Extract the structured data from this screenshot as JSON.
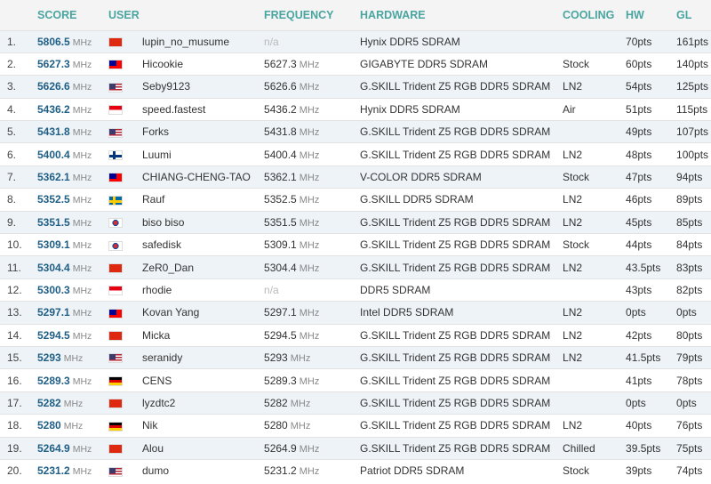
{
  "columns": {
    "score": "SCORE",
    "user": "USER",
    "frequency": "FREQUENCY",
    "hardware": "HARDWARE",
    "cooling": "COOLING",
    "hw": "HW",
    "gl": "GL"
  },
  "flag_styles": {
    "hk": "background:#de2910;",
    "tw": "background:linear-gradient(#000095,#000095) 0 0/8px 6px no-repeat,#fe0000;",
    "us": "background:linear-gradient(#3c3b6e,#3c3b6e) 0 0/7px 6px no-repeat,repeating-linear-gradient(#b22234 0 1.5px,#fff 1.5px 3px);",
    "id": "background:linear-gradient(#e70011 50%,#fff 50%);",
    "fi": "background:linear-gradient(90deg,transparent 4px,#003580 4px 7px,transparent 7px),linear-gradient(transparent 4px,#003580 4px 7px,transparent 7px),#fff;",
    "se": "background:linear-gradient(90deg,transparent 4px,#fecc00 4px 7px,transparent 7px),linear-gradient(transparent 4px,#fecc00 4px 7px,transparent 7px),#006aa7;",
    "kr": "background:radial-gradient(circle,#cd2e3a 0 2.5px,#0047a0 2.5px 3.5px,transparent 3.5px),#fff;",
    "cn": "background:#de2910;",
    "de": "background:linear-gradient(#000 33%,#dd0000 33% 66%,#ffce00 66%);"
  },
  "rows": [
    {
      "rank": "1.",
      "score": "5806.5",
      "score_unit": "MHz",
      "flag": "hk",
      "user": "lupin_no_musume",
      "freq": "n/a",
      "freq_unit": "",
      "hardware": "Hynix DDR5 SDRAM",
      "cooling": "",
      "hw": "70pts",
      "gl": "161pts"
    },
    {
      "rank": "2.",
      "score": "5627.3",
      "score_unit": "MHz",
      "flag": "tw",
      "user": "Hicookie",
      "freq": "5627.3",
      "freq_unit": "MHz",
      "hardware": "GIGABYTE DDR5 SDRAM",
      "cooling": "Stock",
      "hw": "60pts",
      "gl": "140pts"
    },
    {
      "rank": "3.",
      "score": "5626.6",
      "score_unit": "MHz",
      "flag": "us",
      "user": "Seby9123",
      "freq": "5626.6",
      "freq_unit": "MHz",
      "hardware": "G.SKILL Trident Z5 RGB DDR5 SDRAM",
      "cooling": "LN2",
      "hw": "54pts",
      "gl": "125pts"
    },
    {
      "rank": "4.",
      "score": "5436.2",
      "score_unit": "MHz",
      "flag": "id",
      "user": "speed.fastest",
      "freq": "5436.2",
      "freq_unit": "MHz",
      "hardware": "Hynix DDR5 SDRAM",
      "cooling": "Air",
      "hw": "51pts",
      "gl": "115pts"
    },
    {
      "rank": "5.",
      "score": "5431.8",
      "score_unit": "MHz",
      "flag": "us",
      "user": "Forks",
      "freq": "5431.8",
      "freq_unit": "MHz",
      "hardware": "G.SKILL Trident Z5 RGB DDR5 SDRAM",
      "cooling": "",
      "hw": "49pts",
      "gl": "107pts"
    },
    {
      "rank": "6.",
      "score": "5400.4",
      "score_unit": "MHz",
      "flag": "fi",
      "user": "Luumi",
      "freq": "5400.4",
      "freq_unit": "MHz",
      "hardware": "G.SKILL Trident Z5 RGB DDR5 SDRAM",
      "cooling": "LN2",
      "hw": "48pts",
      "gl": "100pts"
    },
    {
      "rank": "7.",
      "score": "5362.1",
      "score_unit": "MHz",
      "flag": "tw",
      "user": "CHIANG-CHENG-TAO",
      "freq": "5362.1",
      "freq_unit": "MHz",
      "hardware": "V-COLOR DDR5 SDRAM",
      "cooling": "Stock",
      "hw": "47pts",
      "gl": "94pts"
    },
    {
      "rank": "8.",
      "score": "5352.5",
      "score_unit": "MHz",
      "flag": "se",
      "user": "Rauf",
      "freq": "5352.5",
      "freq_unit": "MHz",
      "hardware": "G.SKILL DDR5 SDRAM",
      "cooling": "LN2",
      "hw": "46pts",
      "gl": "89pts"
    },
    {
      "rank": "9.",
      "score": "5351.5",
      "score_unit": "MHz",
      "flag": "kr",
      "user": "biso biso",
      "freq": "5351.5",
      "freq_unit": "MHz",
      "hardware": "G.SKILL Trident Z5 RGB DDR5 SDRAM",
      "cooling": "LN2",
      "hw": "45pts",
      "gl": "85pts"
    },
    {
      "rank": "10.",
      "score": "5309.1",
      "score_unit": "MHz",
      "flag": "kr",
      "user": "safedisk",
      "freq": "5309.1",
      "freq_unit": "MHz",
      "hardware": "G.SKILL Trident Z5 RGB DDR5 SDRAM",
      "cooling": "Stock",
      "hw": "44pts",
      "gl": "84pts"
    },
    {
      "rank": "11.",
      "score": "5304.4",
      "score_unit": "MHz",
      "flag": "cn",
      "user": "ZeR0_Dan",
      "freq": "5304.4",
      "freq_unit": "MHz",
      "hardware": "G.SKILL Trident Z5 RGB DDR5 SDRAM",
      "cooling": "LN2",
      "hw": "43.5pts",
      "gl": "83pts"
    },
    {
      "rank": "12.",
      "score": "5300.3",
      "score_unit": "MHz",
      "flag": "id",
      "user": "rhodie",
      "freq": "n/a",
      "freq_unit": "",
      "hardware": "DDR5 SDRAM",
      "cooling": "",
      "hw": "43pts",
      "gl": "82pts"
    },
    {
      "rank": "13.",
      "score": "5297.1",
      "score_unit": "MHz",
      "flag": "tw",
      "user": "Kovan Yang",
      "freq": "5297.1",
      "freq_unit": "MHz",
      "hardware": "Intel DDR5 SDRAM",
      "cooling": "LN2",
      "hw": "0pts",
      "gl": "0pts"
    },
    {
      "rank": "14.",
      "score": "5294.5",
      "score_unit": "MHz",
      "flag": "cn",
      "user": "Micka",
      "freq": "5294.5",
      "freq_unit": "MHz",
      "hardware": "G.SKILL Trident Z5 RGB DDR5 SDRAM",
      "cooling": "LN2",
      "hw": "42pts",
      "gl": "80pts"
    },
    {
      "rank": "15.",
      "score": "5293",
      "score_unit": "MHz",
      "flag": "us",
      "user": "seranidy",
      "freq": "5293",
      "freq_unit": "MHz",
      "hardware": "G.SKILL Trident Z5 RGB DDR5 SDRAM",
      "cooling": "LN2",
      "hw": "41.5pts",
      "gl": "79pts"
    },
    {
      "rank": "16.",
      "score": "5289.3",
      "score_unit": "MHz",
      "flag": "de",
      "user": "CENS",
      "freq": "5289.3",
      "freq_unit": "MHz",
      "hardware": "G.SKILL Trident Z5 RGB DDR5 SDRAM",
      "cooling": "",
      "hw": "41pts",
      "gl": "78pts"
    },
    {
      "rank": "17.",
      "score": "5282",
      "score_unit": "MHz",
      "flag": "cn",
      "user": "lyzdtc2",
      "freq": "5282",
      "freq_unit": "MHz",
      "hardware": "G.SKILL Trident Z5 RGB DDR5 SDRAM",
      "cooling": "",
      "hw": "0pts",
      "gl": "0pts"
    },
    {
      "rank": "18.",
      "score": "5280",
      "score_unit": "MHz",
      "flag": "de",
      "user": "Nik",
      "freq": "5280",
      "freq_unit": "MHz",
      "hardware": "G.SKILL Trident Z5 RGB DDR5 SDRAM",
      "cooling": "LN2",
      "hw": "40pts",
      "gl": "76pts"
    },
    {
      "rank": "19.",
      "score": "5264.9",
      "score_unit": "MHz",
      "flag": "cn",
      "user": "Alou",
      "freq": "5264.9",
      "freq_unit": "MHz",
      "hardware": "G.SKILL Trident Z5 RGB DDR5 SDRAM",
      "cooling": "Chilled",
      "hw": "39.5pts",
      "gl": "75pts"
    },
    {
      "rank": "20.",
      "score": "5231.2",
      "score_unit": "MHz",
      "flag": "us",
      "user": "dumo",
      "freq": "5231.2",
      "freq_unit": "MHz",
      "hardware": "Patriot DDR5 SDRAM",
      "cooling": "Stock",
      "hw": "39pts",
      "gl": "74pts"
    }
  ]
}
